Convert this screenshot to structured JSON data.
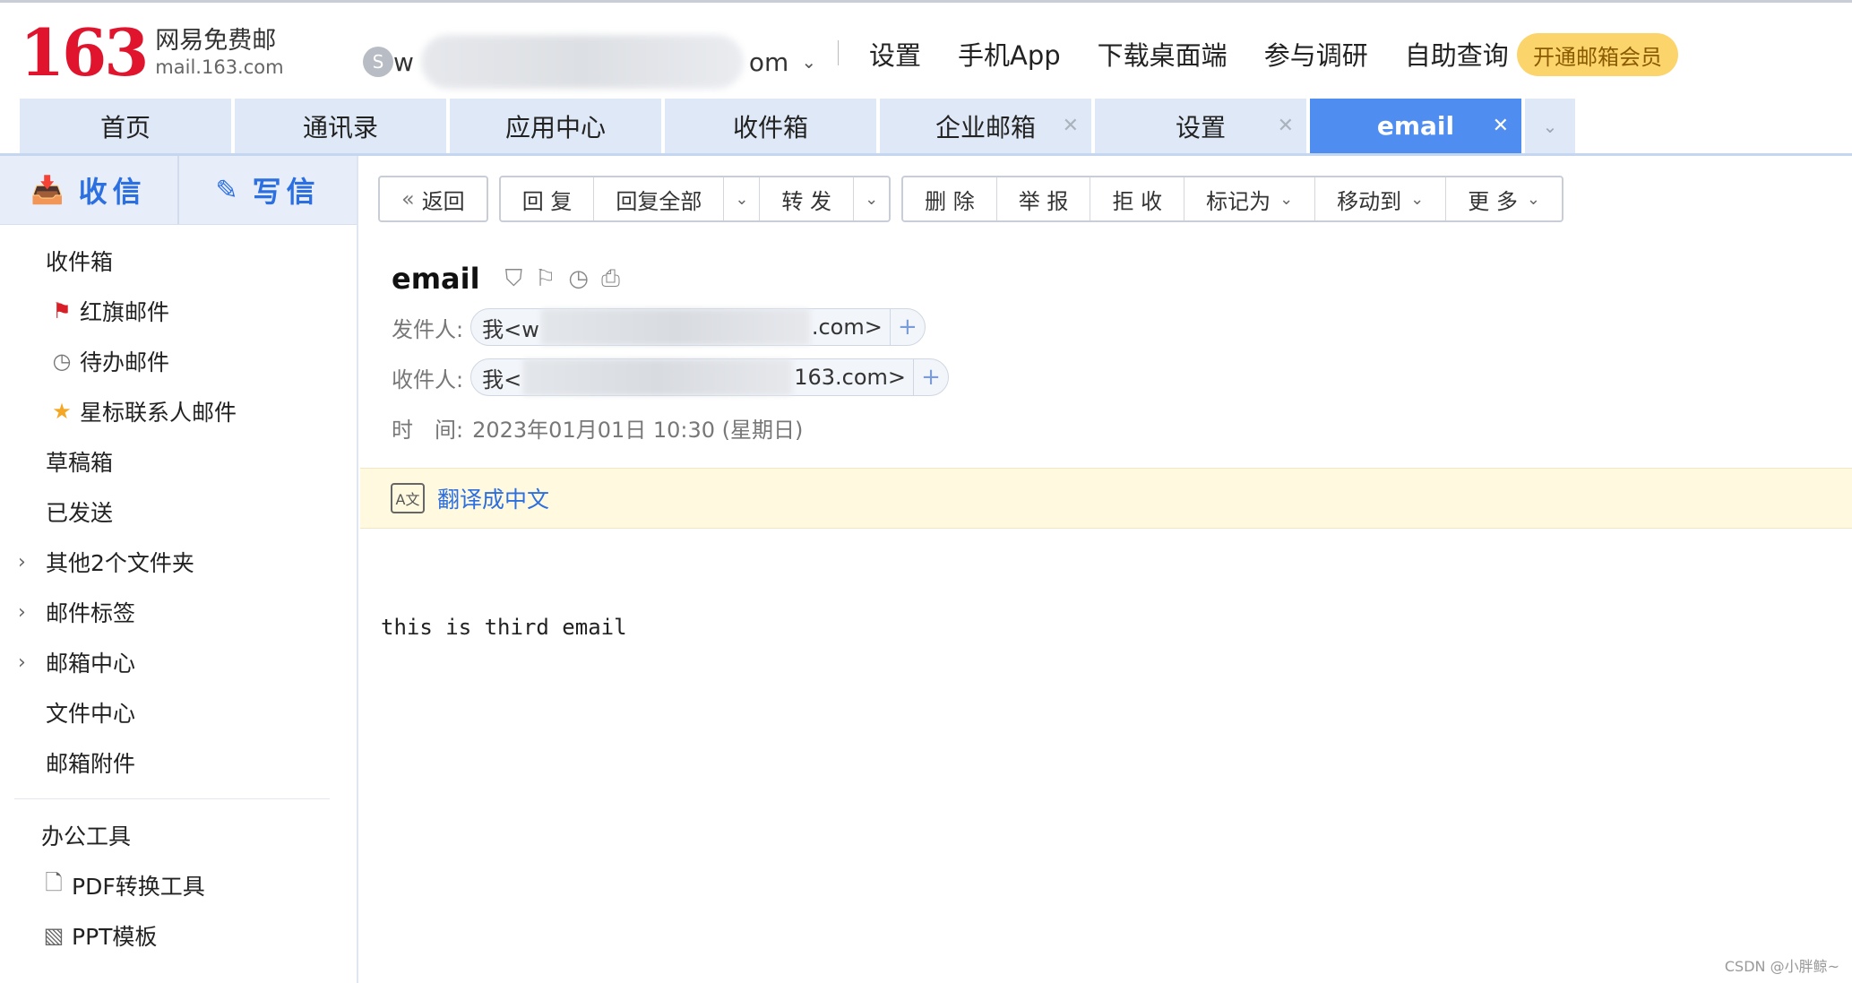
{
  "header": {
    "logo_number": "163",
    "logo_cn": "网易免费邮",
    "logo_domain": "mail.163.com",
    "account_prefix": "w",
    "account_suffix": "om",
    "links": [
      "设置",
      "手机App",
      "下载桌面端",
      "参与调研",
      "自助查询"
    ],
    "vip_label": "开通邮箱会员"
  },
  "tabs": [
    {
      "label": "首页",
      "closable": false
    },
    {
      "label": "通讯录",
      "closable": false
    },
    {
      "label": "应用中心",
      "closable": false
    },
    {
      "label": "收件箱",
      "closable": false
    },
    {
      "label": "企业邮箱",
      "closable": true
    },
    {
      "label": "设置",
      "closable": true
    },
    {
      "label": "email",
      "closable": true,
      "active": true
    }
  ],
  "sidebar": {
    "receive_label": "收信",
    "compose_label": "写信",
    "items": [
      {
        "label": "收件箱"
      },
      {
        "label": "红旗邮件",
        "icon": "flag-icon"
      },
      {
        "label": "待办邮件",
        "icon": "clock-icon"
      },
      {
        "label": "星标联系人邮件",
        "icon": "star-icon"
      },
      {
        "label": "草稿箱"
      },
      {
        "label": "已发送"
      },
      {
        "label": "其他2个文件夹",
        "expandable": true
      },
      {
        "label": "邮件标签",
        "expandable": true
      },
      {
        "label": "邮箱中心",
        "expandable": true
      },
      {
        "label": "文件中心"
      },
      {
        "label": "邮箱附件"
      }
    ],
    "tools_title": "办公工具",
    "tools": [
      {
        "label": "PDF转换工具",
        "icon": "pdf-file-icon"
      },
      {
        "label": "PPT模板",
        "icon": "ppt-template-icon"
      }
    ]
  },
  "toolbar": {
    "back": "返回",
    "reply": "回 复",
    "reply_all": "回复全部",
    "forward": "转 发",
    "delete": "删 除",
    "report": "举 报",
    "reject": "拒 收",
    "mark_as": "标记为",
    "move_to": "移动到",
    "more": "更 多"
  },
  "mail": {
    "subject": "email",
    "from_label": "发件人:",
    "from_prefix": "我<w",
    "from_suffix": ".com>",
    "to_label": "收件人:",
    "to_prefix": "我<",
    "to_suffix": "163.com>",
    "time_label": "时　间:",
    "time_value": "2023年01月01日 10:30 (星期日)",
    "translate_label": "翻译成中文",
    "body": "this is third email"
  },
  "watermark": "CSDN @小胖鲸~",
  "colors": {
    "brand_red": "#e0142d",
    "accent_blue": "#4f8df1",
    "link_blue": "#2c6fe0",
    "vip_yellow": "#fbd46b"
  }
}
